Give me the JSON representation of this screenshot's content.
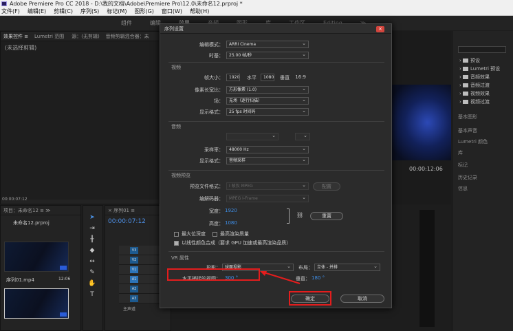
{
  "app": {
    "title": "Adobe Premiere Pro CC 2018 - D:\\我的文档\\Adobe\\Premiere Pro\\12.0\\未命名12.prproj *"
  },
  "menu": [
    "文件(F)",
    "编辑(E)",
    "剪辑(C)",
    "序列(S)",
    "标记(M)",
    "图形(G)",
    "窗口(W)",
    "帮助(H)"
  ],
  "workspace": {
    "tabs": [
      "组件",
      "编辑",
      "效果",
      "音频",
      "图形",
      "库",
      "工作区",
      "Editing",
      "≫"
    ],
    "active": 2
  },
  "source_panel": {
    "tabs": [
      "效果控件 ≡",
      "Lumetri 范围",
      "源：(无剪辑)",
      "音频剪辑混合器：未"
    ],
    "empty": "(未选择剪辑)",
    "timecode": "00:00:07:12"
  },
  "project_panel": {
    "tab": "项目：未命名12 ≡  ≫",
    "project": "未命名12.prproj",
    "items": [
      {
        "name": "序列01.mp4",
        "duration": "12:06"
      }
    ]
  },
  "timeline": {
    "tab": "× 序列01 ≡",
    "timecode": "00:00:07:12",
    "tracks": [
      "V3",
      "V2",
      "V1",
      "A1",
      "A2",
      "A3"
    ],
    "master": "主声道"
  },
  "program": {
    "timecode": "00:00:12:06"
  },
  "right_panel": {
    "search_placeholder": "",
    "folders": [
      "预设",
      "Lumetri 预设",
      "音频效果",
      "音频过渡",
      "视频效果",
      "视频过渡"
    ],
    "sections": [
      "基本图形",
      "基本声音",
      "Lumetri 颜色",
      "库",
      "标记",
      "历史记录",
      "信息"
    ]
  },
  "dialog": {
    "title": "序列设置",
    "close": "×",
    "editing_mode_label": "编辑模式：",
    "editing_mode": "ARRI Cinema",
    "timebase_label": "时基：",
    "timebase": "25.00 帧/秒",
    "video_section": "视频",
    "frame_size_label": "帧大小：",
    "frame_w": "1920",
    "h_label": "水平",
    "frame_h": "1080",
    "v_label": "垂直",
    "ratio": "16:9",
    "pixel_aspect_label": "像素长宽比：",
    "pixel_aspect": "方形像素 (1.0)",
    "fields_label": "场：",
    "fields": "无场（逐行扫描）",
    "display_format_label": "显示格式：",
    "display_format": "25 fps 时间码",
    "audio_section": "音频",
    "sample_rate_label": "采样率：",
    "sample_rate": "48000 Hz",
    "audio_format_label": "显示格式：",
    "audio_format": "音频采样",
    "preview_section": "视频预览",
    "preview_format_label": "预览文件格式：",
    "preview_format": "I 帧仅 MPEG",
    "codec_label": "编解码器：",
    "codec": "MPEG I-Frame",
    "width_label": "宽度：",
    "width": "1920",
    "height_label": "高度：",
    "height": "1080",
    "reset": "重置",
    "configure": "配置",
    "max_bit_depth": "最大位深度",
    "max_render_quality": "最高渲染质量",
    "linear_color": "以线性颜色合成（要求 GPU 加速或最高渲染品质）",
    "vr_section": "VR 属性",
    "projection_label": "投影：",
    "projection": "球面投影",
    "layout_label": "布局：",
    "layout": "立体 - 并排",
    "hfov_label": "水平捕捉的视图：",
    "hfov": "300 °",
    "vfov_label": "垂直：",
    "vfov": "180 °",
    "ok": "确定",
    "cancel": "取消"
  }
}
